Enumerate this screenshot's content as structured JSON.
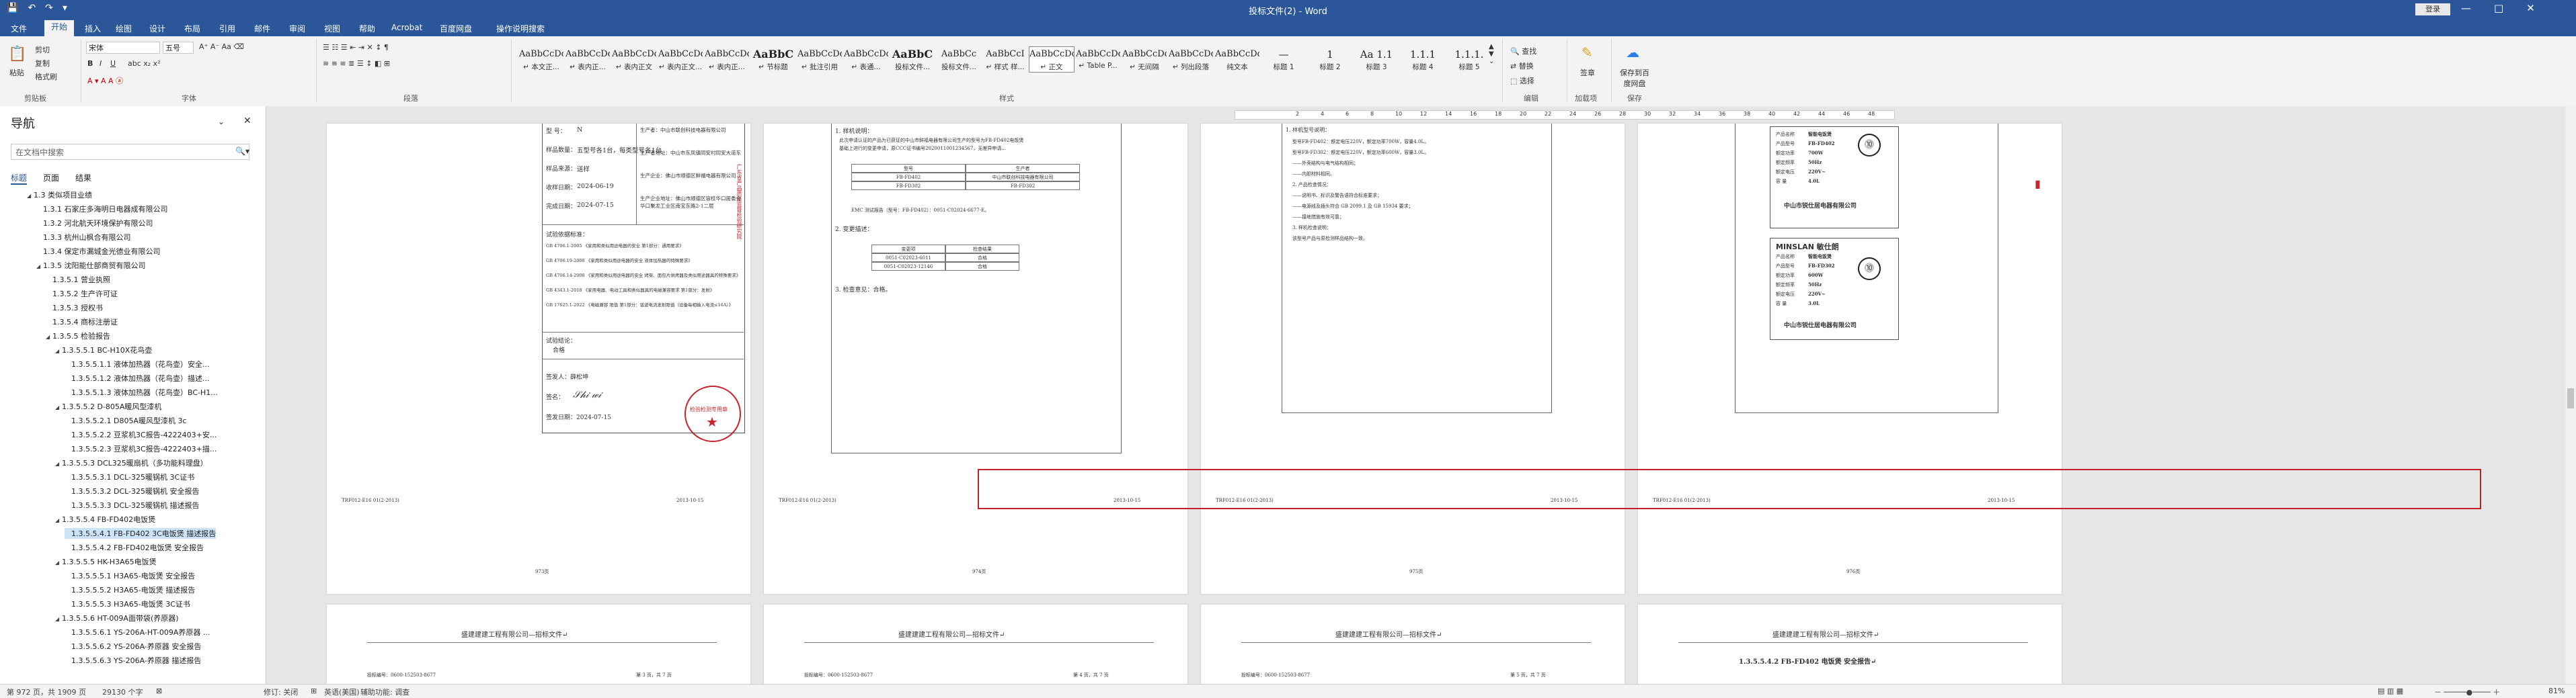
{
  "window": {
    "title": "投标文件(2) - Word",
    "login": "登录",
    "controls": [
      "—",
      "□",
      "✕"
    ]
  },
  "quick_access": [
    "save-icon",
    "undo-icon",
    "redo-icon",
    "customize-icon"
  ],
  "tabs": [
    {
      "label": "文件"
    },
    {
      "label": "开始"
    },
    {
      "label": "插入"
    },
    {
      "label": "绘图"
    },
    {
      "label": "设计"
    },
    {
      "label": "布局"
    },
    {
      "label": "引用"
    },
    {
      "label": "邮件"
    },
    {
      "label": "审阅"
    },
    {
      "label": "视图"
    },
    {
      "label": "帮助"
    },
    {
      "label": "Acrobat"
    },
    {
      "label": "百度网盘"
    },
    {
      "label": "操作说明搜索"
    }
  ],
  "ribbon": {
    "clipboard": {
      "paste": "粘贴",
      "cut": "剪切",
      "copy": "复制",
      "format_painter": "格式刷",
      "group": "剪贴板"
    },
    "font": {
      "name": "宋体",
      "size": "五号",
      "group": "字体"
    },
    "paragraph": {
      "group": "段落"
    },
    "styles": {
      "group": "样式",
      "items": [
        {
          "sample": "AaBbCcDdI",
          "name": "↵ 本文正..."
        },
        {
          "sample": "AaBbCcDdI",
          "name": "↵ 表内正..."
        },
        {
          "sample": "AaBbCcDdI",
          "name": "↵ 表内正文"
        },
        {
          "sample": "AaBbCcDdI",
          "name": "↵ 表内正文..."
        },
        {
          "sample": "AaBbCcDdE",
          "name": "↵ 表内正..."
        },
        {
          "sample": "AaBbC",
          "name": "↵ 节标题"
        },
        {
          "sample": "AaBbCcDdI",
          "name": "↵ 批注引用"
        },
        {
          "sample": "AaBbCcDdI",
          "name": "↵ 表通..."
        },
        {
          "sample": "AaBbC",
          "name": "投标文件..."
        },
        {
          "sample": "AaBbCc",
          "name": "投标文件..."
        },
        {
          "sample": "AaBbCcI",
          "name": "↵ 样式 样..."
        },
        {
          "sample": "AaBbCcDdI",
          "name": "↵ 正文"
        },
        {
          "sample": "AaBbCcDd",
          "name": "↵ Table P..."
        },
        {
          "sample": "AaBbCcDdI",
          "name": "↵ 无间隔"
        },
        {
          "sample": "AaBbCcDdI",
          "name": "↵ 列出段落"
        },
        {
          "sample": "AaBbCcDdI",
          "name": "纯文本"
        },
        {
          "sample": "—",
          "name": "标题 1"
        },
        {
          "sample": "1",
          "name": "标题 2"
        },
        {
          "sample": "Aa 1.1",
          "name": "标题 3"
        },
        {
          "sample": "1.1.1",
          "name": "标题 4"
        },
        {
          "sample": "1.1.1.",
          "name": "标题 5"
        }
      ]
    },
    "editing": {
      "find": "查找",
      "replace": "替换",
      "select": "选择",
      "group": "编辑"
    },
    "sign": {
      "label": "签章",
      "group": "加载项"
    },
    "baidu": {
      "label": "保存到百度网盘",
      "group": "保存"
    }
  },
  "nav": {
    "title": "导航",
    "search_placeholder": "在文档中搜索",
    "tabs": [
      "标题",
      "页面",
      "结果"
    ],
    "items": [
      {
        "level": 1,
        "text": "1.3 类似项目业绩"
      },
      {
        "level": 2,
        "text": "1.3.1 石家庄多海明日电器成有限公司"
      },
      {
        "level": 2,
        "text": "1.3.2 河北航天环境保护有限公司"
      },
      {
        "level": 2,
        "text": "1.3.3 杭州山枫合有限公司"
      },
      {
        "level": 2,
        "text": "1.3.4 保定市漏城金光德业有限公司"
      },
      {
        "level": 2,
        "text": "1.3.5 沈阳能仕部商贸有限公司"
      },
      {
        "level": 3,
        "text": "1.3.5.1 营业执照"
      },
      {
        "level": 3,
        "text": "1.3.5.2 生产许可证"
      },
      {
        "level": 3,
        "text": "1.3.5.3 授权书"
      },
      {
        "level": 3,
        "text": "1.3.5.4 商标注册证"
      },
      {
        "level": 3,
        "text": "1.3.5.5 检验报告"
      },
      {
        "level": 4,
        "text": "1.3.5.5.1 BC-H10X花鸟壶"
      },
      {
        "level": 5,
        "text": "1.3.5.5.1.1 液体加热器（花鸟壶）安全..."
      },
      {
        "level": 5,
        "text": "1.3.5.5.1.2 液体加热器（花鸟壶）描述..."
      },
      {
        "level": 5,
        "text": "1.3.5.5.1.3 液体加热器（花鸟壶）BC-H1..."
      },
      {
        "level": 4,
        "text": "1.3.5.5.2 D-805A暖风型漆机"
      },
      {
        "level": 5,
        "text": "1.3.5.5.2.1 D805A暖风型漆机 3c"
      },
      {
        "level": 5,
        "text": "1.3.5.5.2.2 豆浆机3C报告-4222403+安..."
      },
      {
        "level": 5,
        "text": "1.3.5.5.2.3 豆浆机3C报告-4222403+描..."
      },
      {
        "level": 4,
        "text": "1.3.5.5.3 DCL325暖扇机（多功能料理盘）"
      },
      {
        "level": 5,
        "text": "1.3.5.5.3.1 DCL-325暖锅机 3C证书"
      },
      {
        "level": 5,
        "text": "1.3.5.5.3.2 DCL-325暖锅机 安全报告"
      },
      {
        "level": 5,
        "text": "1.3.5.5.3.3 DCL-325暖锅机 描述报告"
      },
      {
        "level": 4,
        "text": "1.3.5.5.4 FB-FD402电饭煲"
      },
      {
        "level": 5,
        "text": "1.3.5.5.4.1 FB-FD402 3C电饭煲 描述报告"
      },
      {
        "level": 5,
        "text": "1.3.5.5.4.2 FB-FD402电饭煲 安全报告"
      },
      {
        "level": 4,
        "text": "1.3.5.5.5 HK-H3A65电饭煲"
      },
      {
        "level": 5,
        "text": "1.3.5.5.5.1 H3A65-电饭煲 安全报告"
      },
      {
        "level": 5,
        "text": "1.3.5.5.5.2 H3A65-电饭煲 描述报告"
      },
      {
        "level": 5,
        "text": "1.3.5.5.5.3 H3A65-电饭煲 3C证书"
      },
      {
        "level": 4,
        "text": "1.3.5.5.6 HT-009A面带袋(养原器)"
      },
      {
        "level": 5,
        "text": "1.3.5.5.6.1 YS-206A-HT-009A养原器 ..."
      },
      {
        "level": 5,
        "text": "1.3.5.5.6.2 YS-206A-养原器 安全报告"
      },
      {
        "level": 5,
        "text": "1.3.5.5.6.3 YS-206A-养原器 描述报告"
      }
    ],
    "selected_index": 24
  },
  "ruler": [
    "2",
    "4",
    "6",
    "8",
    "10",
    "12",
    "14",
    "16",
    "18",
    "20",
    "22",
    "24",
    "26",
    "28",
    "30",
    "32",
    "34",
    "36",
    "38",
    "40",
    "42",
    "44",
    "46",
    "48"
  ],
  "document": {
    "page1": {
      "rows": [
        {
          "k": "型    号：",
          "v": "N"
        },
        {
          "k": "样品数量：",
          "v": "五型号各1台，每类型号各1台"
        },
        {
          "k": "样品来源：",
          "v": "送样"
        },
        {
          "k": "收样日期：",
          "v": "2024-06-19"
        },
        {
          "k": "完成日期：",
          "v": "2024-07-15"
        }
      ],
      "right_rows": [
        "生产者：中山市联创科技电器有限公司",
        "生产者地址：中山市东凤镇同安村同安大道东",
        "生产企业：佛山市顺德区鲜福电器有限公司",
        "生产企业地址：佛山市顺德区容桂华口居委会华口聚龙工业区南宝东路2-1二层"
      ],
      "basis_title": "试验依据标准：",
      "basis": [
        "GB 4706.1-2005 《家用和类似用途电器的安全 第1部分：通用要求》",
        "GB 4706.19-2008 《家用和类似用途电器的安全 液体加热器的特殊要求》",
        "GB 4706.14-2008 《家用和类似用途电器的安全 烤架、面包片烘烤器及类似用途器具的特殊要求》",
        "GB 4343.1-2018 《家用电器、电动工具和类似器具的电磁兼容要求 第1部分：发射》",
        "GB 17625.1-2022 《电磁兼容 限值 第1部分：谐波电流发射限值（设备每相输入电流≤16A）》"
      ],
      "conclusion_title": "试验结论：",
      "conclusion": "合格",
      "approver": "签发人：",
      "approver_name": "薛松坤",
      "signer": "签名：",
      "date": "签发日期：2024-07-15",
      "stamp": "检验检测专用章",
      "side_note": "广东省产品质量监督检验研究院"
    },
    "page2": {
      "title": "1. 样机说明：",
      "lines": [
        "此次申请认证的产品为已获证的中山市鲜福电器有限公司生产的型号为FB-FD402电饭煲",
        "基础上进行的变更申请，原CCC证书编号2020011001234567，无差异申请..."
      ],
      "table": [
        [
          "型号",
          "生产者"
        ],
        [
          "FB-FD402",
          "中山市联创科技电器有限公司"
        ],
        [
          "FB-FD302",
          "FB-FD302"
        ]
      ],
      "emc": "EMC 测试报告（型号：FB-FD402）：0051-C02024-6677-E。",
      "section2": "2. 变更描述：",
      "table2": [
        [
          "变更项",
          "检查结果"
        ],
        [
          "0051-C02023-6011",
          "合格"
        ],
        [
          "0051-C02023-12146",
          "合格"
        ]
      ],
      "section3": "3. 检查意见：合格。"
    },
    "page3": {
      "title": "1. 样机型号说明：",
      "lines": [
        "型号FB-FD402：额定电压220V，额定功率700W，容量4.0L。",
        "型号FB-FD302：额定电压220V，额定功率600W，容量3.0L。",
        "——外壳结构与电气结构相同；",
        "——内胆材料相同。",
        "2. 产品检查情况：",
        "——说明书、标识及警告语符合标准要求；",
        "——电源线及插头符合 GB 2099.1 及 GB 15934 要求；",
        "——接地措施有效可靠；",
        "3. 样机检查说明：",
        "该型号产品与原检测样品结构一致。"
      ]
    },
    "page4": {
      "labels": [
        {
          "brand": "",
          "product": "智能电饭煲",
          "model": "FB-FD402",
          "power": "700W",
          "freq": "50Hz",
          "voltage": "220V~",
          "capacity": "4.0L",
          "maker": "中山市锐仕居电器有限公司"
        },
        {
          "brand": "MINSLAN 敏仕朗",
          "product": "智能电饭煲",
          "model": "FB-FD302",
          "power": "600W",
          "freq": "50Hz",
          "voltage": "220V~",
          "capacity": "3.0L",
          "maker": "中山市锐仕居电器有限公司"
        }
      ],
      "field_names": {
        "product": "产品名称",
        "model": "产品型号",
        "power": "额定功率",
        "freq": "额定频率",
        "voltage": "额定电压",
        "capacity": "容    量"
      }
    },
    "footers": [
      {
        "left": "TRF012-E16 01(2-2013)",
        "right": "2013-10-15"
      },
      {
        "left": "TRF012-E16 01(2-2013)",
        "right": "2013-10-15"
      },
      {
        "left": "TRF012-E16 01(2-2013)",
        "right": "2013-10-15"
      },
      {
        "left": "TRF012-E16 01(2-2013)",
        "right": "2013-10-15"
      }
    ],
    "page_marks": [
      "973页",
      "974页",
      "975页",
      "976页"
    ],
    "next_header": "盛建建建工程有限公司—招标文件↵",
    "next_sub": [
      {
        "left": "投标编号：0600-152503-8677",
        "right": "第 3 页，共 7 页"
      },
      {
        "left": "投标编号：0600-152503-8677",
        "right": "第 4 页，共 7 页"
      },
      {
        "left": "投标编号：0600-152503-8677",
        "right": "第 5 页，共 7 页"
      },
      {
        "left": "",
        "right": ""
      }
    ],
    "next_heading": "1.3.5.5.4.2   FB-FD402 电饭煲 安全报告↵"
  },
  "status": {
    "page": "第 972 页，共 1909 页",
    "words": "29130 个字",
    "revise": "修订: 关闭",
    "lang": "英语(美国)",
    "accessibility": "辅助功能: 调查",
    "zoom": "81%"
  },
  "colors": {
    "accent": "#2b579a",
    "highlight": "#c0202a",
    "stamp": "#c9242b"
  }
}
